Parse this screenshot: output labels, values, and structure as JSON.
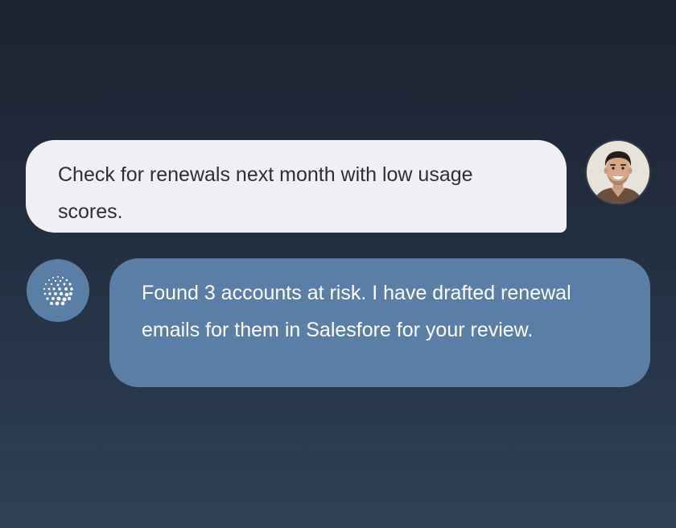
{
  "conversation": {
    "user_message": {
      "text": "Check for renewals next month with low usage scores.",
      "avatar_icon": "user-photo-icon"
    },
    "assistant_message": {
      "text": "Found 3 accounts at risk. I have drafted renewal emails for them in Salesfore for your review.",
      "avatar_icon": "ai-dot-sphere-icon"
    }
  },
  "colors": {
    "user_bubble": "#f0f0f4",
    "assistant_bubble": "#5b7ea6",
    "background_top": "#1c2331",
    "background_bottom": "#2f4157"
  }
}
